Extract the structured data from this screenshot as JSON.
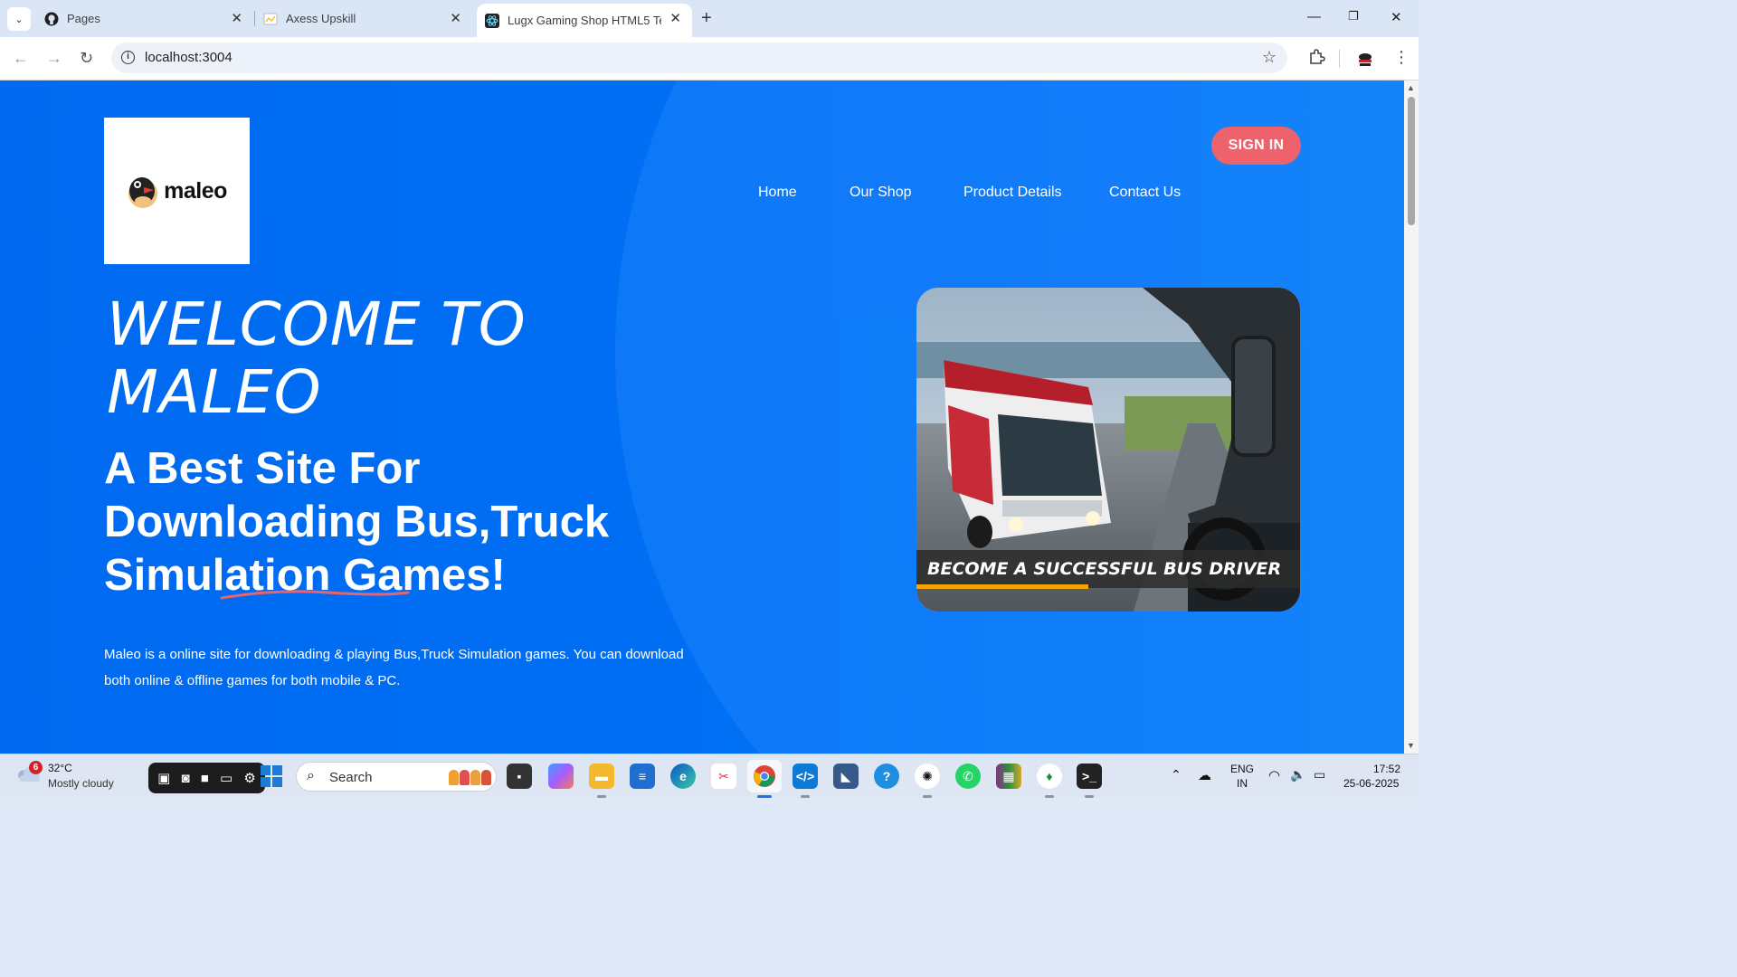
{
  "browser": {
    "tabs": [
      {
        "title": "Pages",
        "icon": "github-icon",
        "active": false
      },
      {
        "title": "Axess Upskill",
        "icon": "page-icon",
        "active": false
      },
      {
        "title": "Lugx Gaming Shop HTML5 Tem",
        "icon": "react-icon",
        "active": true
      }
    ],
    "url": "localhost:3004"
  },
  "page": {
    "logo_text": "maleo",
    "nav": [
      "Home",
      "Our Shop",
      "Product Details",
      "Contact Us"
    ],
    "signin_label": "SIGN IN",
    "welcome": "WELCOME TO MALEO",
    "headline": "A Best Site For Downloading Bus,Truck Simulation Games!",
    "description": "Maleo is a online site for downloading & playing Bus,Truck Simulation games. You can download both online & offline games for both mobile & PC.",
    "hero_caption": "BECOME A SUCCESSFUL BUS DRIVER",
    "colors": {
      "background": "#0071f8",
      "signin": "#ee626b"
    }
  },
  "taskbar": {
    "weather": {
      "temp": "32°C",
      "desc": "Mostly cloudy",
      "badge": "6"
    },
    "search_placeholder": "Search",
    "tray": {
      "lang1": "ENG",
      "lang2": "IN",
      "time": "17:52",
      "date": "25-06-2025"
    }
  }
}
